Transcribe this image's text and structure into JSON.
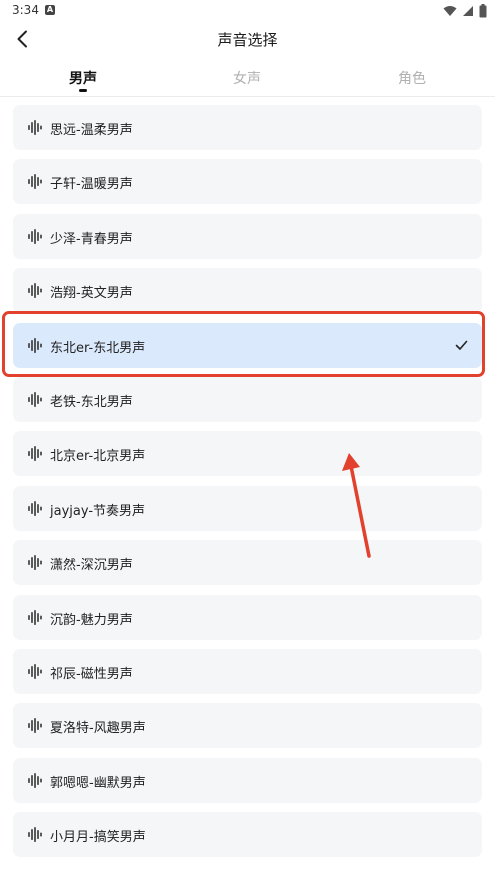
{
  "status_bar": {
    "time": "3:34",
    "notification_badge": "A"
  },
  "header": {
    "title": "声音选择"
  },
  "tabs": [
    {
      "label": "男声",
      "active": true
    },
    {
      "label": "女声",
      "active": false
    },
    {
      "label": "角色",
      "active": false
    }
  ],
  "voices": [
    {
      "name": "思远-温柔男声",
      "selected": false
    },
    {
      "name": "子轩-温暖男声",
      "selected": false
    },
    {
      "name": "少泽-青春男声",
      "selected": false
    },
    {
      "name": "浩翔-英文男声",
      "selected": false
    },
    {
      "name": "东北er-东北男声",
      "selected": true
    },
    {
      "name": "老铁-东北男声",
      "selected": false
    },
    {
      "name": "北京er-北京男声",
      "selected": false
    },
    {
      "name": "jayjay-节奏男声",
      "selected": false
    },
    {
      "name": "潇然-深沉男声",
      "selected": false
    },
    {
      "name": "沉韵-魅力男声",
      "selected": false
    },
    {
      "name": "祁辰-磁性男声",
      "selected": false
    },
    {
      "name": "夏洛特-风趣男声",
      "selected": false
    },
    {
      "name": "郭嗯嗯-幽默男声",
      "selected": false
    },
    {
      "name": "小月月-搞笑男声",
      "selected": false
    }
  ],
  "colors": {
    "selected_bg": "#dbe9fc",
    "item_bg": "#f5f6f8",
    "annotation_red": "#e2412e"
  },
  "icons": {
    "back": "chevron-left-icon",
    "voice": "sound-wave-icon",
    "selected": "check-icon"
  }
}
